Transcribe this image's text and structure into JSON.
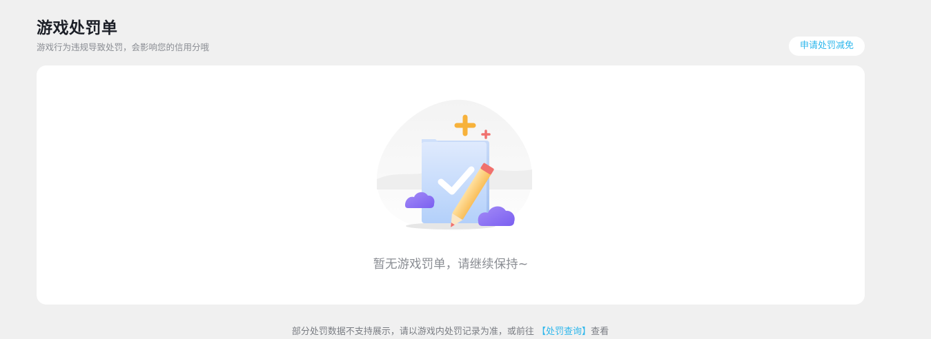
{
  "header": {
    "title": "游戏处罚单",
    "subtitle": "游戏行为违规导致处罚，会影响您的信用分哦",
    "reduce_button_label": "申请处罚减免"
  },
  "empty_state": {
    "message": "暂无游戏罚单，请继续保持~",
    "illustration_icon": "checklist-pencil-icon"
  },
  "footer": {
    "note_prefix": "部分处罚数据不支持展示，请以游戏内处罚记录为准，或前往 ",
    "link_label": "【处罚查询】",
    "note_suffix": "查看"
  },
  "colors": {
    "background": "#f0f0f0",
    "card": "#ffffff",
    "accent": "#2eb7ec",
    "title": "#1c1f27",
    "muted": "#8a8d93"
  }
}
